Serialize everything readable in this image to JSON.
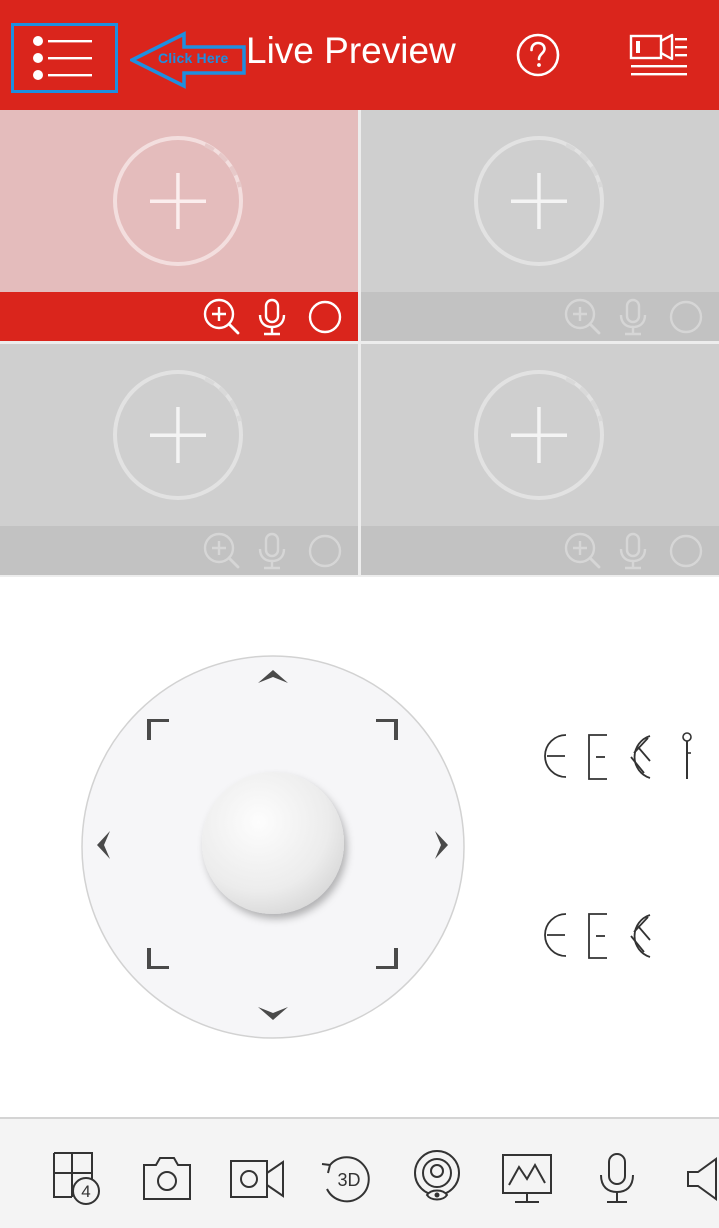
{
  "header": {
    "title": "Live Preview",
    "annotation_label": "Click Here",
    "menu_icon": "menu-list-icon",
    "help_icon": "question-circle-icon",
    "recording_icon": "video-list-icon",
    "accent_color": "#da251c",
    "annotation_color": "#1e8fe0"
  },
  "video_grid": {
    "windows": [
      {
        "state": "selected",
        "add_icon": "add-camera-icon"
      },
      {
        "state": "idle",
        "add_icon": "add-camera-icon"
      },
      {
        "state": "idle",
        "add_icon": "add-camera-icon"
      },
      {
        "state": "idle",
        "add_icon": "add-camera-icon"
      }
    ],
    "window_controls": [
      "zoom-in-icon",
      "microphone-icon",
      "record-circle-icon"
    ]
  },
  "ptz": {
    "directions": [
      "up",
      "up-right",
      "right",
      "down-right",
      "down",
      "down-left",
      "left",
      "up-left"
    ],
    "center": "joystick-knob",
    "side_controls_row1": [
      "zoom-icon",
      "focus-icon",
      "iris-icon",
      "wiper-icon"
    ],
    "side_controls_row2": [
      "zoom-icon",
      "focus-icon",
      "iris-icon"
    ]
  },
  "toolbar": {
    "items": [
      {
        "icon": "window-split-icon",
        "badge": "4"
      },
      {
        "icon": "camera-snapshot-icon"
      },
      {
        "icon": "video-record-icon"
      },
      {
        "icon": "rotate-3d-icon",
        "label": "3D"
      },
      {
        "icon": "fisheye-icon"
      },
      {
        "icon": "monitor-chart-icon"
      },
      {
        "icon": "microphone-icon"
      },
      {
        "icon": "speaker-icon"
      }
    ]
  }
}
